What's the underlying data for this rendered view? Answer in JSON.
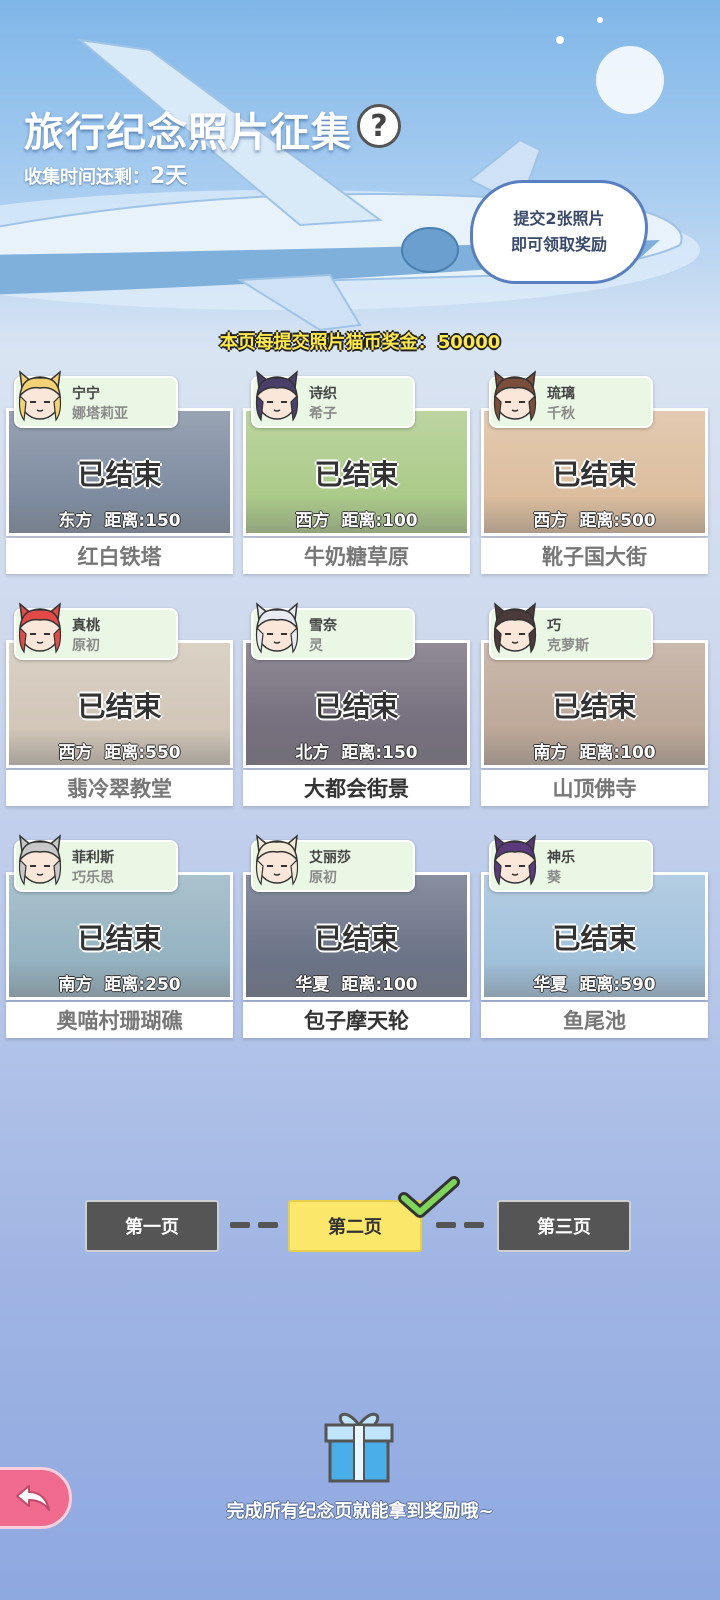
{
  "header": {
    "title": "旅行纪念照片征集",
    "help_icon": "?",
    "countdown_label": "收集时间还剩：",
    "countdown_value": "2天",
    "bubble_line1": "提交2张照片",
    "bubble_line2": "即可领取奖励",
    "bonus_label": "本页每提交照片猫币奖金：",
    "bonus_value": "50000"
  },
  "cards": [
    {
      "tag1": "宁宁",
      "tag2": "娜塔莉亚",
      "status": "已结束",
      "direction": "东方",
      "distance": "距离:150",
      "name": "红白铁塔",
      "bg": "#3a4f6e",
      "hair": "#f2d275"
    },
    {
      "tag1": "诗织",
      "tag2": "希子",
      "status": "已结束",
      "direction": "西方",
      "distance": "距离:100",
      "name": "牛奶糖草原",
      "bg": "#7fae4a",
      "hair": "#4a3f6a"
    },
    {
      "tag1": "琉璃",
      "tag2": "千秋",
      "status": "已结束",
      "direction": "西方",
      "distance": "距离:500",
      "name": "靴子国大街",
      "bg": "#c99a6a",
      "hair": "#7a4e3a"
    },
    {
      "tag1": "真桃",
      "tag2": "原初",
      "status": "已结束",
      "direction": "西方",
      "distance": "距离:550",
      "name": "翡冷翠教堂",
      "bg": "#b9a892",
      "hair": "#e24a4a"
    },
    {
      "tag1": "雪奈",
      "tag2": "灵",
      "status": "已结束",
      "direction": "北方",
      "distance": "距离:150",
      "name": "大都会街景",
      "bg": "#2c2238",
      "hair": "#e8ecf2",
      "active": true
    },
    {
      "tag1": "巧",
      "tag2": "克萝斯",
      "status": "已结束",
      "direction": "南方",
      "distance": "距离:100",
      "name": "山顶佛寺",
      "bg": "#9a7a62",
      "hair": "#4a3a3a"
    },
    {
      "tag1": "菲利斯",
      "tag2": "巧乐思",
      "status": "已结束",
      "direction": "南方",
      "distance": "距离:250",
      "name": "奥喵村珊瑚礁",
      "bg": "#5c8aa0",
      "hair": "#c8c8c8"
    },
    {
      "tag1": "艾丽莎",
      "tag2": "原初",
      "status": "已结束",
      "direction": "华夏",
      "distance": "距离:100",
      "name": "包子摩天轮",
      "bg": "#1c2848",
      "hair": "#f4ead8",
      "active": true
    },
    {
      "tag1": "神乐",
      "tag2": "葵",
      "status": "已结束",
      "direction": "华夏",
      "distance": "距离:590",
      "name": "鱼尾池",
      "bg": "#6fa0c8",
      "hair": "#5a3a7a"
    }
  ],
  "pager": {
    "page1": "第一页",
    "page2": "第二页",
    "page3": "第三页"
  },
  "footer": {
    "text": "完成所有纪念页就能拿到奖励哦~"
  },
  "colors": {
    "accent_yellow": "#fbe86a",
    "back_pink": "#f06a8e"
  }
}
